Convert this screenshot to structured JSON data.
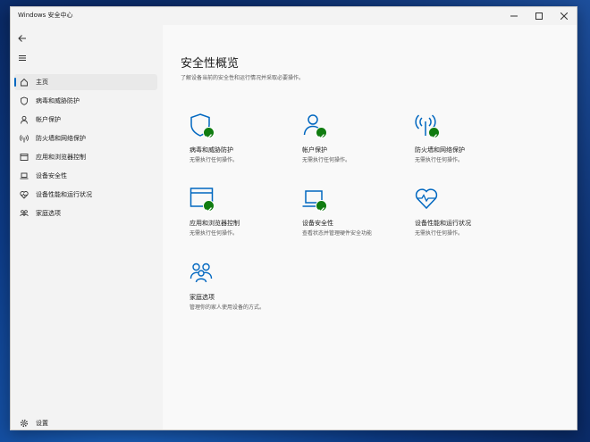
{
  "window": {
    "title": "Windows 安全中心"
  },
  "sidebar": {
    "items": [
      {
        "label": "主页"
      },
      {
        "label": "病毒和威胁防护"
      },
      {
        "label": "帐户保护"
      },
      {
        "label": "防火墙和网络保护"
      },
      {
        "label": "应用和浏览器控制"
      },
      {
        "label": "设备安全性"
      },
      {
        "label": "设备性能和运行状况"
      },
      {
        "label": "家庭选项"
      }
    ],
    "settings_label": "设置"
  },
  "main": {
    "title": "安全性概览",
    "subtitle": "了解设备当前的安全性和运行情况并采取必要操作。",
    "tiles": [
      {
        "name": "病毒和威胁防护",
        "status": "无需执行任何操作。",
        "icon": "shield-icon"
      },
      {
        "name": "帐户保护",
        "status": "无需执行任何操作。",
        "icon": "person-icon"
      },
      {
        "name": "防火墙和网络保护",
        "status": "无需执行任何操作。",
        "icon": "wireless-icon"
      },
      {
        "name": "应用和浏览器控制",
        "status": "无需执行任何操作。",
        "icon": "app-window-icon"
      },
      {
        "name": "设备安全性",
        "status": "查看状态并管理硬件安全功能",
        "icon": "laptop-icon"
      },
      {
        "name": "设备性能和运行状况",
        "status": "无需执行任何操作。",
        "icon": "heart-pulse-icon"
      },
      {
        "name": "家庭选项",
        "status": "管理你的家人使用设备的方式。",
        "icon": "family-icon"
      }
    ]
  },
  "colors": {
    "accent": "#0067c0",
    "ok": "#107c10"
  }
}
